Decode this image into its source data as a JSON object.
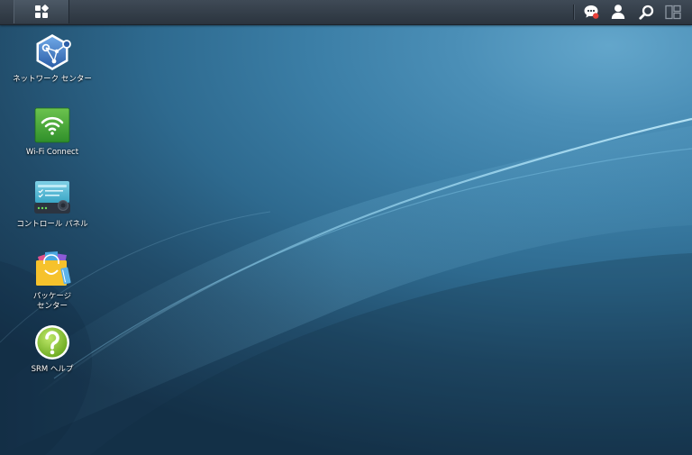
{
  "taskbar": {
    "main_menu_icon": "grid-menu-icon",
    "tray": [
      {
        "name": "notifications",
        "icon": "chat-bubble-icon",
        "has_alert": true
      },
      {
        "name": "user",
        "icon": "user-icon"
      },
      {
        "name": "search",
        "icon": "search-icon"
      },
      {
        "name": "widgets",
        "icon": "widgets-icon"
      }
    ]
  },
  "desktop": {
    "icons": [
      {
        "id": "network-center",
        "icon": "network-center-icon",
        "label": "ネットワーク センター"
      },
      {
        "id": "wifi-connect",
        "icon": "wifi-icon",
        "label": "Wi-Fi Connect"
      },
      {
        "id": "control-panel",
        "icon": "control-panel-icon",
        "label": "コントロール パネル"
      },
      {
        "id": "package-center",
        "icon": "package-bag-icon",
        "label": "パッケージ センター"
      },
      {
        "id": "srm-help",
        "icon": "help-question-icon",
        "label": "SRM ヘルプ"
      }
    ]
  },
  "colors": {
    "taskbar": "#2f3943",
    "wallpaper_light": "#63a6cb",
    "wallpaper_dark": "#15324a",
    "alert_dot": "#e8413a"
  }
}
